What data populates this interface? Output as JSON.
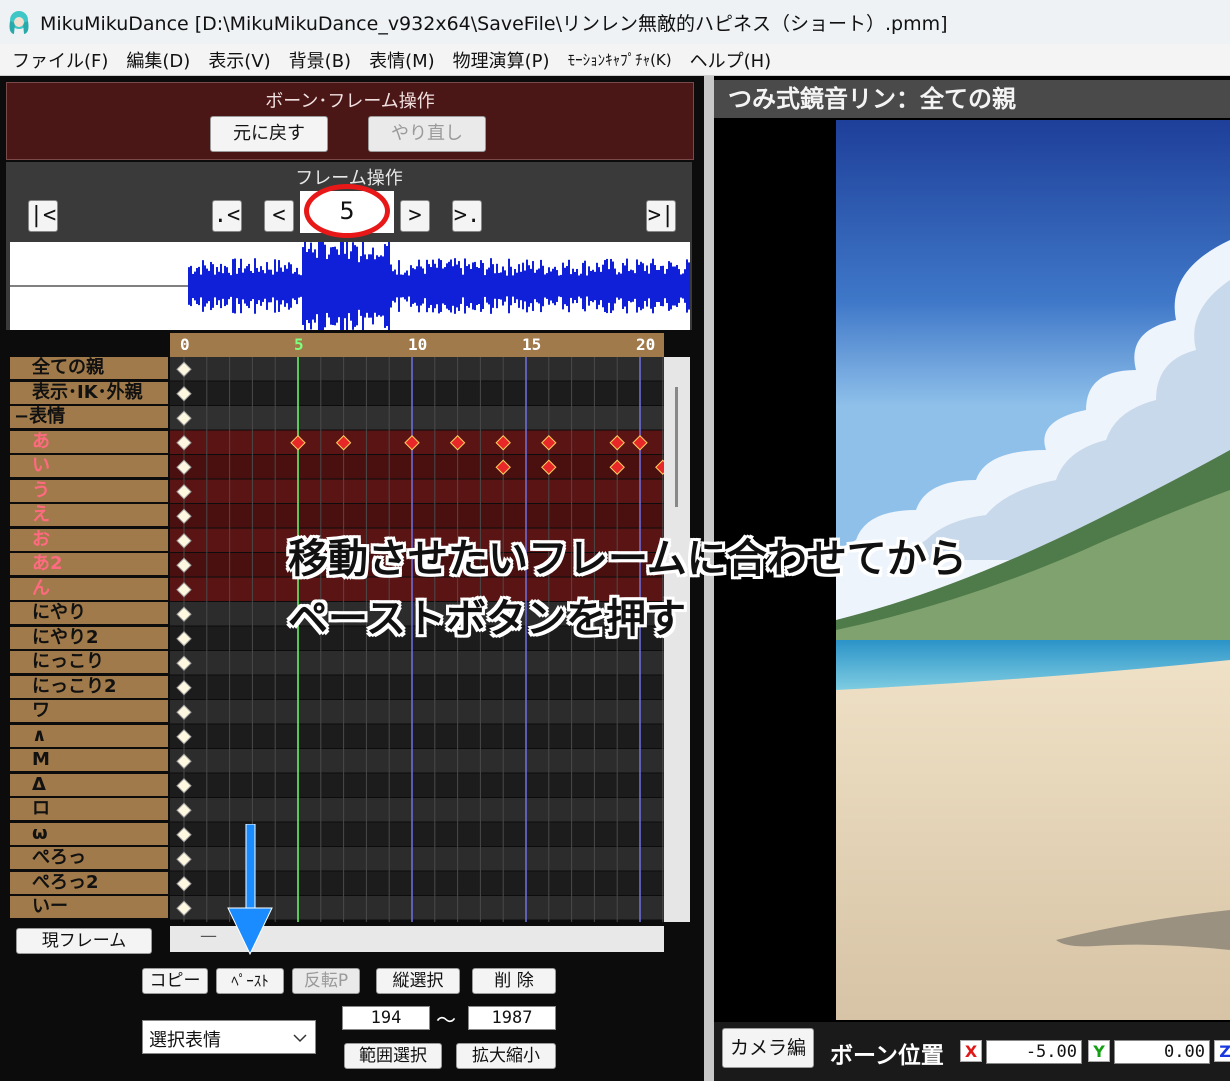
{
  "window": {
    "title": "MikuMikuDance [D:\\MikuMikuDance_v932x64\\SaveFile\\リンレン無敵的ハピネス（ショート）.pmm]"
  },
  "menu": [
    "ファイル(F)",
    "編集(D)",
    "表示(V)",
    "背景(B)",
    "表情(M)",
    "物理演算(P)",
    "ﾓｰｼｮﾝｷｬﾌﾟﾁｬ(K)",
    "ヘルプ(H)"
  ],
  "bone_panel": {
    "title": "ボーン･フレーム操作",
    "undo": "元に戻す",
    "redo": "やり直し"
  },
  "frame_panel": {
    "title": "フレーム操作",
    "current_frame": "5",
    "nav": {
      "first": "|<",
      "prev_key": ".<",
      "prev": "<",
      "next": ">",
      "next_key": ">.",
      "last": ">|"
    }
  },
  "timeline": {
    "ruler": [
      "0",
      "5",
      "10",
      "15",
      "20"
    ],
    "current_frame": 5,
    "rows": [
      {
        "label": "全ての親",
        "type": "bone"
      },
      {
        "label": "表示･IK･外親",
        "type": "bone"
      },
      {
        "label": "−表情",
        "type": "group"
      },
      {
        "label": "あ",
        "type": "morph-active",
        "keys": [
          0,
          5,
          7,
          10,
          12,
          14,
          16,
          19,
          20
        ]
      },
      {
        "label": "い",
        "type": "morph-active",
        "keys": [
          0,
          14,
          16,
          19,
          21
        ]
      },
      {
        "label": "う",
        "type": "morph-active",
        "keys": [
          0
        ]
      },
      {
        "label": "え",
        "type": "morph-active",
        "keys": [
          0
        ]
      },
      {
        "label": "お",
        "type": "morph-active",
        "keys": [
          0
        ]
      },
      {
        "label": "あ2",
        "type": "morph-active",
        "keys": [
          0
        ]
      },
      {
        "label": "ん",
        "type": "morph-active",
        "keys": [
          0
        ]
      },
      {
        "label": "にやり",
        "type": "morph",
        "keys": [
          0
        ]
      },
      {
        "label": "にやり2",
        "type": "morph",
        "keys": [
          0
        ]
      },
      {
        "label": "にっこり",
        "type": "morph",
        "keys": [
          0
        ]
      },
      {
        "label": "にっこり2",
        "type": "morph",
        "keys": [
          0
        ]
      },
      {
        "label": "ワ",
        "type": "morph",
        "keys": [
          0
        ]
      },
      {
        "label": "∧",
        "type": "morph",
        "keys": [
          0
        ]
      },
      {
        "label": "M",
        "type": "morph",
        "keys": [
          0
        ]
      },
      {
        "label": "Δ",
        "type": "morph",
        "keys": [
          0
        ]
      },
      {
        "label": "ロ",
        "type": "morph",
        "keys": [
          0
        ]
      },
      {
        "label": "ω",
        "type": "morph",
        "keys": [
          0
        ]
      },
      {
        "label": "ぺろっ",
        "type": "morph",
        "keys": [
          0
        ]
      },
      {
        "label": "ぺろっ2",
        "type": "morph",
        "keys": [
          0
        ]
      },
      {
        "label": "いー",
        "type": "morph",
        "keys": [
          0
        ]
      }
    ]
  },
  "current_frame_button": "現フレーム",
  "current_frame_value": "—",
  "ops": {
    "copy": "コピー",
    "paste": "ﾍﾟｰｽﾄ",
    "flip_paste": "反転P",
    "vertical_select": "縦選択",
    "delete": "削 除",
    "selector": "選択表情",
    "range_from": "194",
    "range_tilde": "～",
    "range_to": "1987",
    "range_select": "範囲選択",
    "scale": "拡大縮小"
  },
  "annotation": {
    "line1": "移動させたいフレームに合わせてから",
    "line2": "ペーストボタンを押す",
    "arrow_color": "#1a8cff",
    "ring_color": "#e81818"
  },
  "viewport": {
    "model_title": "つみ式鏡音リン：全ての親"
  },
  "bottom": {
    "camera_button": "カメラ編",
    "bone_position": "ボーン位置",
    "x_label": "X",
    "x_value": "-5.00",
    "y_label": "Y",
    "y_value": "0.00",
    "z_label": "Z"
  }
}
